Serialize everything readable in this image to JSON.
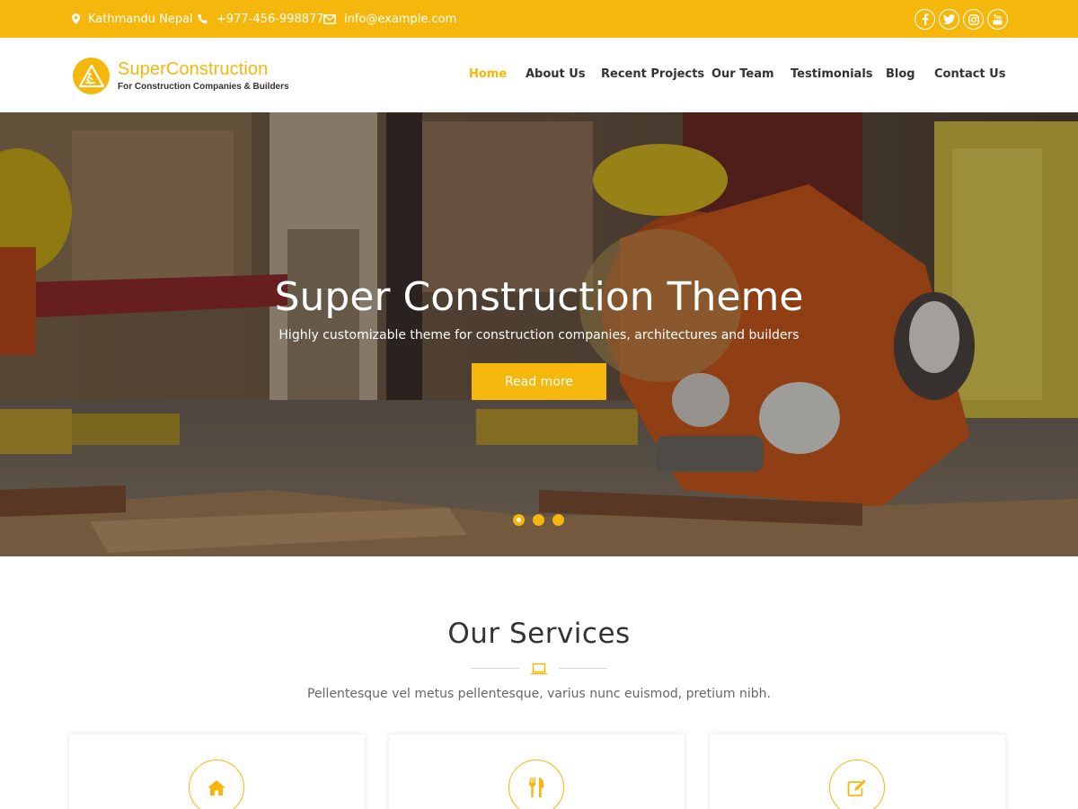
{
  "topbar": {
    "location": "Kathmandu Nepal",
    "phone": "+977-456-998877",
    "email": "info@example.com",
    "social": [
      "facebook-icon",
      "twitter-icon",
      "instagram-icon",
      "youtube-icon"
    ]
  },
  "brand": {
    "name": "SuperConstruction",
    "tagline": "For Construction Companies & Builders",
    "accent_color": "#f6b70c"
  },
  "nav": {
    "items": [
      {
        "label": "Home",
        "active": true
      },
      {
        "label": "About Us"
      },
      {
        "label": "Recent Projects"
      },
      {
        "label": "Our Team"
      },
      {
        "label": "Testimonials"
      },
      {
        "label": "Blog"
      },
      {
        "label": "Contact Us"
      }
    ]
  },
  "hero": {
    "title": "Super Construction Theme",
    "subtitle": "Highly customizable theme for construction companies, architectures and builders",
    "button_label": "Read more",
    "slides": 3,
    "active_slide": 1
  },
  "services": {
    "title": "Our Services",
    "description": "Pellentesque vel metus pellentesque, varius nunc euismod, pretium nibh.",
    "section_icon": "laptop-icon",
    "cards": [
      {
        "icon": "home-icon"
      },
      {
        "icon": "cutlery-icon"
      },
      {
        "icon": "edit-icon"
      }
    ]
  }
}
